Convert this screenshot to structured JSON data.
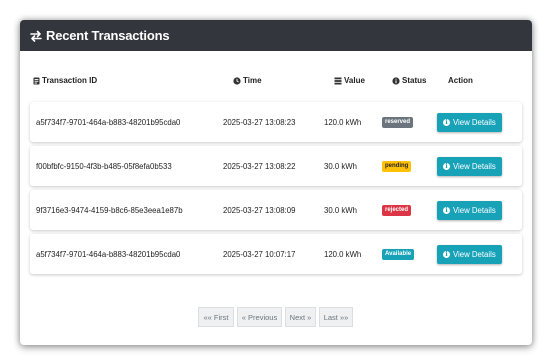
{
  "header": {
    "title": "Recent Transactions",
    "icon": "exchange-icon"
  },
  "columns": {
    "id": "Transaction ID",
    "time": "Time",
    "value": "Value",
    "status": "Status",
    "action": "Action"
  },
  "rows": [
    {
      "id": "a5f734f7-9701-464a-b883-48201b95cda0",
      "time": "2025-03-27 13:08:23",
      "value": "120.0 kWh",
      "status": "reserved",
      "status_color": "#6c757d",
      "action": "View Details"
    },
    {
      "id": "f00bfbfc-9150-4f3b-b485-05f8efa0b533",
      "time": "2025-03-27 13:08:22",
      "value": "30.0 kWh",
      "status": "pending",
      "status_color": "#ffc107",
      "action": "View Details"
    },
    {
      "id": "9f3716e3-9474-4159-b8c6-85e3eea1e87b",
      "time": "2025-03-27 13:08:09",
      "value": "30.0 kWh",
      "status": "rejected",
      "status_color": "#dc3545",
      "action": "View Details"
    },
    {
      "id": "a5f734f7-9701-464a-b883-48201b95cda0",
      "time": "2025-03-27 10:07:17",
      "value": "120.0 kWh",
      "status": "Available",
      "status_color": "#17a2b8",
      "action": "View Details"
    }
  ],
  "pagination": {
    "first": "«« First",
    "previous": "« Previous",
    "next": "Next »",
    "last": "Last »»"
  },
  "colors": {
    "header_bg": "#33373d",
    "button": "#17a2b8"
  }
}
